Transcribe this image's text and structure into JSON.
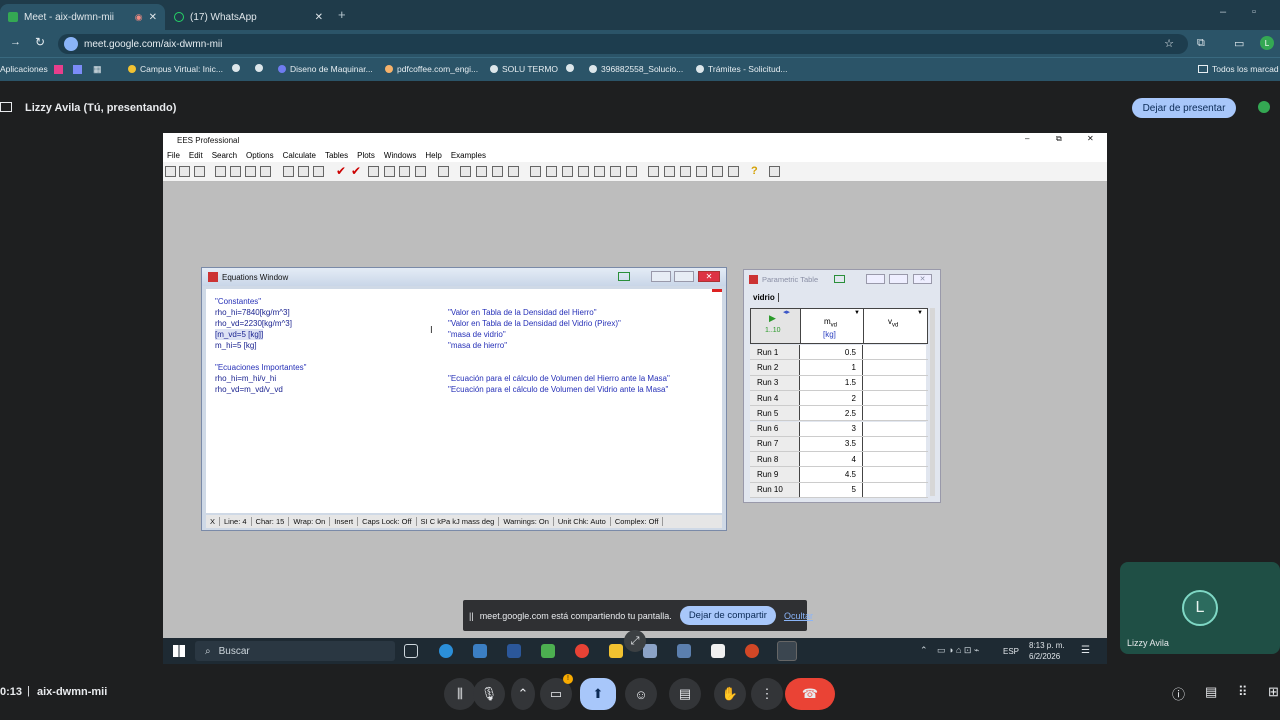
{
  "browser": {
    "tabs": [
      {
        "label": "Meet - aix-dwmn-mii"
      },
      {
        "label": "(17) WhatsApp"
      }
    ],
    "url": "meet.google.com/aix-dwmn-mii",
    "bookmarks": [
      "Aplicaciones",
      "Campus Virtual: Inic...",
      "Diseno de Maquinar...",
      "pdfcoffee.com_engi...",
      "SOLU TERMO",
      "396882558_Solucio...",
      "Trámites - Solicitud..."
    ],
    "all_bookmarks": "Todos los marcad"
  },
  "meet": {
    "presenter_label": "Lizzy Avila (Tú, presentando)",
    "stop_presenting": "Dejar de presentar",
    "share_notice": "meet.google.com está compartiendo tu pantalla.",
    "stop_sharing": "Dejar de compartir",
    "hide": "Ocultar",
    "self_initial": "L",
    "self_name": "Lizzy Avila",
    "clock": "0:13",
    "meeting_code": "aix-dwmn-mii"
  },
  "ees": {
    "title": "EES Professional",
    "menu": [
      "File",
      "Edit",
      "Search",
      "Options",
      "Calculate",
      "Tables",
      "Plots",
      "Windows",
      "Help",
      "Examples"
    ],
    "equations_title": "Equations Window",
    "equations": [
      {
        "code": "\"Constantes\"",
        "comment": ""
      },
      {
        "code": "rho_hi=7840[kg/m^3]",
        "comment": "\"Valor en Tabla de la Densidad del Hierro\""
      },
      {
        "code": "rho_vd=2230[kg/m^3]",
        "comment": "\"Valor en Tabla de la Densidad del Vidrio (Pirex)\""
      },
      {
        "code": "[m_vd=5 [kg]]",
        "comment": "\"masa de vidrio\""
      },
      {
        "code": "m_hi=5 [kg]",
        "comment": "\"masa de hierro\""
      },
      {
        "code": "\"Ecuaciones Importantes\"",
        "comment": ""
      },
      {
        "code": "rho_hi=m_hi/v_hi",
        "comment": "\"Ecuación para el cálculo de Volumen del Hierro ante la Masa\""
      },
      {
        "code": "rho_vd=m_vd/v_vd",
        "comment": "\"Ecuación para el cálculo de Volumen del Vidrio ante la Masa\""
      }
    ],
    "status": [
      "X",
      "Line: 4",
      "Char: 15",
      "Wrap: On",
      "Insert",
      "Caps Lock: Off",
      "SI C kPa kJ mass deg",
      "Warnings: On",
      "Unit Chk: Auto",
      "Complex: Off"
    ],
    "param_title": "Parametric Table",
    "param_tab": "vidrio",
    "param_range": "1..10",
    "col1_name": "m",
    "col1_sub": "vd",
    "col1_unit": "[kg]",
    "col2_name": "v",
    "col2_sub": "vd",
    "rows": [
      {
        "run": "Run 1",
        "m": "0.5"
      },
      {
        "run": "Run 2",
        "m": "1"
      },
      {
        "run": "Run 3",
        "m": "1.5"
      },
      {
        "run": "Run 4",
        "m": "2"
      },
      {
        "run": "Run 5",
        "m": "2.5"
      },
      {
        "run": "Run 6",
        "m": "3"
      },
      {
        "run": "Run 7",
        "m": "3.5"
      },
      {
        "run": "Run 8",
        "m": "4"
      },
      {
        "run": "Run 9",
        "m": "4.5"
      },
      {
        "run": "Run 10",
        "m": "5"
      }
    ]
  },
  "taskbar": {
    "search": "Buscar",
    "lang": "ESP",
    "time": "8:13 p. m.",
    "date": "6/2/2026"
  }
}
